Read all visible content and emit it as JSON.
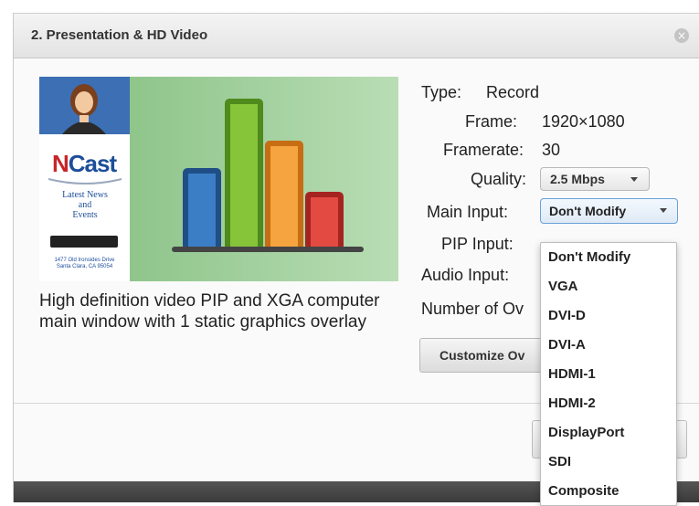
{
  "dialog": {
    "title": "2. Presentation & HD Video",
    "close_glyph": "×"
  },
  "preview": {
    "logo_text_n": "N",
    "logo_text_rest": "Cast",
    "news_line1": "Latest News",
    "news_line2": "and",
    "news_line3": "Events",
    "address_line1": "1477 Old Ironsides Drive",
    "address_line2": "Santa Clara, CA 95054"
  },
  "description": "High definition video PIP and XGA computer main window with 1 static graphics overlay",
  "properties": {
    "type_label": "Type:",
    "type_value": "Record",
    "frame_label": "Frame:",
    "frame_value": "1920×1080",
    "framerate_label": "Framerate:",
    "framerate_value": "30",
    "quality_label": "Quality:",
    "quality_value": "2.5 Mbps",
    "main_input_label": "Main Input:",
    "main_input_value": "Don't Modify",
    "pip_input_label": "PIP Input:",
    "audio_input_label": "Audio Input:",
    "overlays_label": "Number of Ov"
  },
  "customize_button": "Customize Ov",
  "main_input_options": [
    "Don't Modify",
    "VGA",
    "DVI-D",
    "DVI-A",
    "HDMI-1",
    "HDMI-2",
    "DisplayPort",
    "SDI",
    "Composite"
  ],
  "colors": {
    "bar_blue": "#2f6fb6",
    "bar_green": "#76b82a",
    "bar_orange": "#f0902a",
    "bar_red": "#d93a34",
    "accent_blue": "#6aa0d8"
  },
  "icons": {
    "close": "close-icon",
    "caret": "chevron-down-icon"
  }
}
